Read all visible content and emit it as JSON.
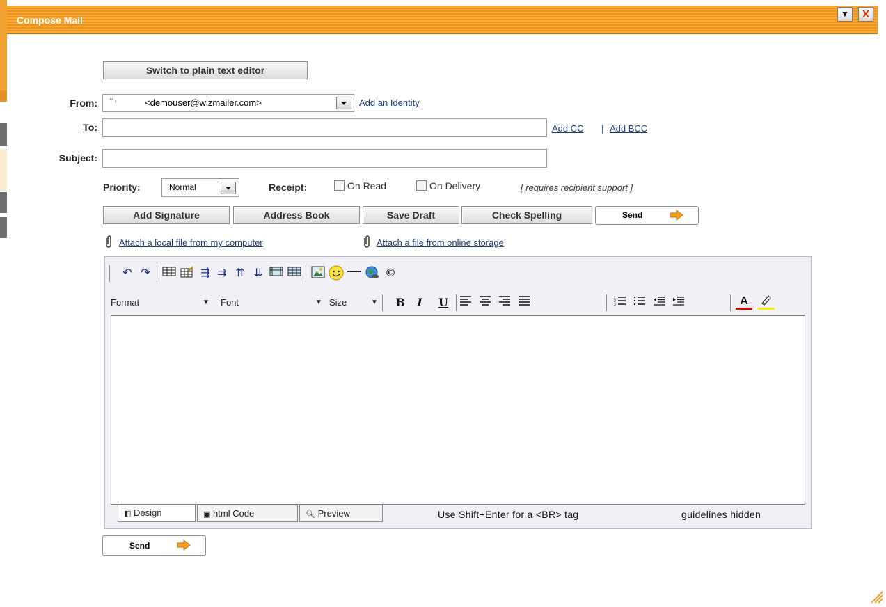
{
  "window": {
    "title": "Compose Mail",
    "minimize_icon": "▼",
    "close_icon": "X"
  },
  "editor_toggle": "Switch to plain text editor",
  "from": {
    "label": "From:",
    "value_prefix": "\"\" ‹",
    "value": "<demouser@wizmailer.com>",
    "add_identity": "Add an Identity"
  },
  "to": {
    "label": "To:",
    "value": "",
    "add_cc": "Add CC",
    "separator": "|",
    "add_bcc": "Add BCC"
  },
  "subject": {
    "label": "Subject:",
    "value": ""
  },
  "priority": {
    "label": "Priority:",
    "value": "Normal"
  },
  "receipt": {
    "label": "Receipt:",
    "on_read": "On Read",
    "on_delivery": "On Delivery",
    "note": "[ requires recipient support ]"
  },
  "actions": {
    "add_signature": "Add Signature",
    "address_book": "Address Book",
    "save_draft": "Save Draft",
    "check_spelling": "Check Spelling",
    "send": "Send"
  },
  "attach": {
    "local": "Attach a local file from my computer",
    "online": "Attach a file from online storage"
  },
  "toolbar": {
    "format": "Format",
    "font": "Font",
    "size": "Size",
    "bold": "B",
    "italic": "I",
    "underline": "U",
    "font_color": "A"
  },
  "tabs": {
    "design": "Design",
    "html": "html Code",
    "preview": "Preview"
  },
  "status": {
    "hint": "Use Shift+Enter for a <BR> tag",
    "guidelines": "guidelines hidden"
  },
  "bottom_send": "Send",
  "colors": {
    "title_orange": "#ef9418",
    "link": "#1f3d7a",
    "send_arrow": "#f5a020"
  }
}
